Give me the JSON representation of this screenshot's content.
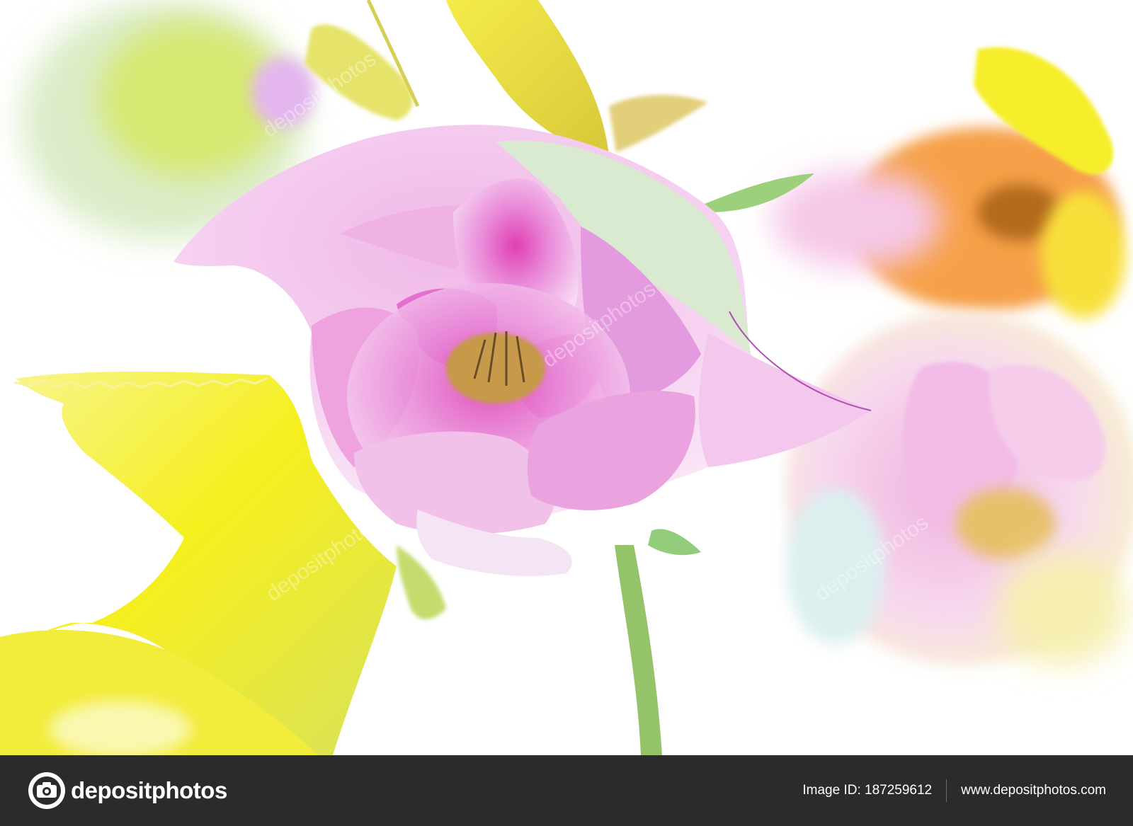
{
  "photo": {
    "subject": "pink hellebore flower with yellow leaves on white background",
    "watermark_text": "depositphotos",
    "colors": {
      "petal": "#e58ad6",
      "petal_light": "#f3c9ee",
      "leaf": "#f2ec2a",
      "stem": "#9bc56a",
      "orange": "#f39a3a"
    }
  },
  "footer": {
    "logo_text": "depositphotos",
    "image_id_label": "Image ID: 187259612",
    "website": "www.depositphotos.com",
    "background": "#2b2b2b"
  }
}
